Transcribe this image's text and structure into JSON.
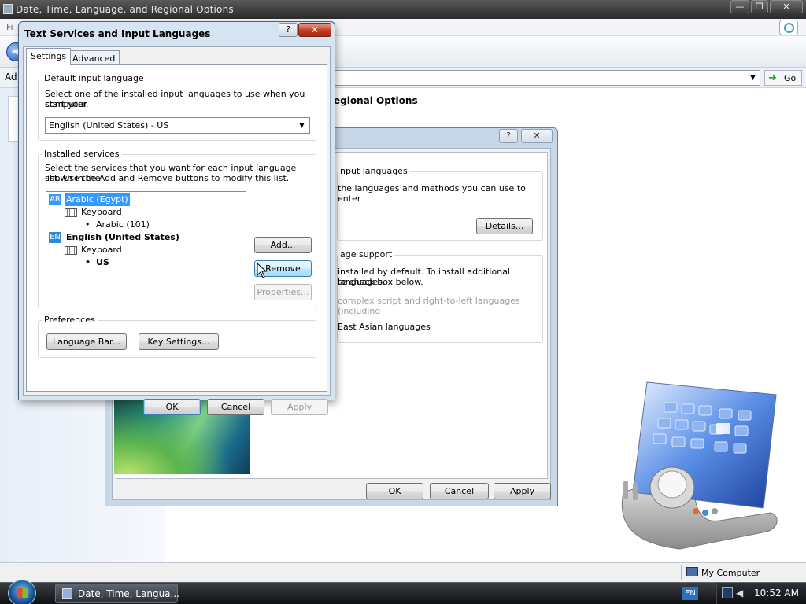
{
  "main_window": {
    "title": "Date, Time, Language, and Regional Options",
    "menu_first": "Fi",
    "address_label": "Ad",
    "go_label": "Go",
    "content_heading": "egional Options",
    "status_text": "My Computer",
    "controls": {
      "minimize": "—",
      "restore": "❐",
      "close": "✕"
    }
  },
  "background_dialog": {
    "help": "?",
    "close": "✕",
    "section1_legend": "nput languages",
    "section1_text": "the languages and methods you can use to enter",
    "details_button": "Details...",
    "section2_legend": "age support",
    "section2_line1": "installed by default. To install additional languages,",
    "section2_line2": "te check box below.",
    "option1": "complex script and right-to-left languages (including",
    "option2": "East Asian languages",
    "ok": "OK",
    "cancel": "Cancel",
    "apply": "Apply"
  },
  "dialog": {
    "title": "Text Services and Input Languages",
    "help": "?",
    "close": "✕",
    "tabs": [
      {
        "label": "Settings",
        "active": true
      },
      {
        "label": "Advanced",
        "active": false
      }
    ],
    "default_input": {
      "legend": "Default input language",
      "description_line1": "Select one of the installed input languages to use when you start your",
      "description_line2": "computer.",
      "selected": "English (United States) - US"
    },
    "installed": {
      "legend": "Installed services",
      "description_line1": "Select the services that you want for each input language shown in the",
      "description_line2": "list. Use the Add and Remove buttons to modify this list.",
      "tree": [
        {
          "badge": "AR",
          "label": "Arabic (Egypt)",
          "selected": true
        },
        {
          "label": "Keyboard"
        },
        {
          "label": "Arabic (101)"
        },
        {
          "badge": "EN",
          "label": "English (United States)",
          "bold": true
        },
        {
          "label": "Keyboard"
        },
        {
          "label": "US",
          "bold": true
        }
      ],
      "bullet": "•",
      "add_button": "Add...",
      "remove_button": "Remove",
      "properties_button": "Properties..."
    },
    "preferences": {
      "legend": "Preferences",
      "language_bar_button": "Language Bar...",
      "key_settings_button": "Key Settings..."
    },
    "ok": "OK",
    "cancel": "Cancel",
    "apply": "Apply"
  },
  "taskbar": {
    "task_label": "Date, Time, Langua...",
    "language_indicator": "EN",
    "clock": "10:52 AM"
  },
  "colors": {
    "selection": "#3399ff",
    "badge_ar": "#3399ff",
    "badge_en": "#2b8ad6",
    "title_bar": "#2a2a2a"
  }
}
